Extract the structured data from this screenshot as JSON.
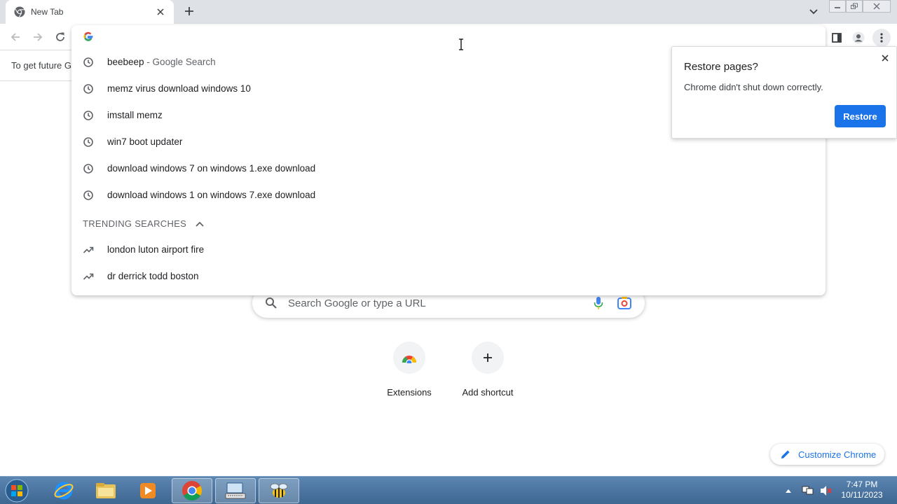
{
  "tab": {
    "title": "New Tab"
  },
  "infobar": {
    "message": "To get future G"
  },
  "omnibox": {
    "suggestions": [
      {
        "text": "beebeep",
        "suffix": " - Google Search"
      },
      {
        "text": "memz virus download windows 10"
      },
      {
        "text": "imstall memz"
      },
      {
        "text": "win7 boot updater"
      },
      {
        "text": "download windows 7 on windows 1.exe download"
      },
      {
        "text": "download windows 1 on windows 7.exe download"
      }
    ],
    "trending_header": "TRENDING SEARCHES",
    "trending": [
      {
        "text": "london luton airport fire"
      },
      {
        "text": "dr derrick todd boston"
      }
    ]
  },
  "restore": {
    "title": "Restore pages?",
    "body": "Chrome didn't shut down correctly.",
    "button": "Restore"
  },
  "ntp": {
    "search_placeholder": "Search Google or type a URL",
    "shortcuts": [
      {
        "label": "Extensions",
        "icon": "chrome-web-store-icon"
      },
      {
        "label": "Add shortcut",
        "icon": "plus-icon"
      }
    ],
    "customize_label": "Customize Chrome"
  },
  "taskbar": {
    "time": "7:47 PM",
    "date": "10/11/2023"
  },
  "colors": {
    "accent": "#1a73e8",
    "tabstrip": "#dee1e6",
    "taskbar": "#4a76a3"
  }
}
